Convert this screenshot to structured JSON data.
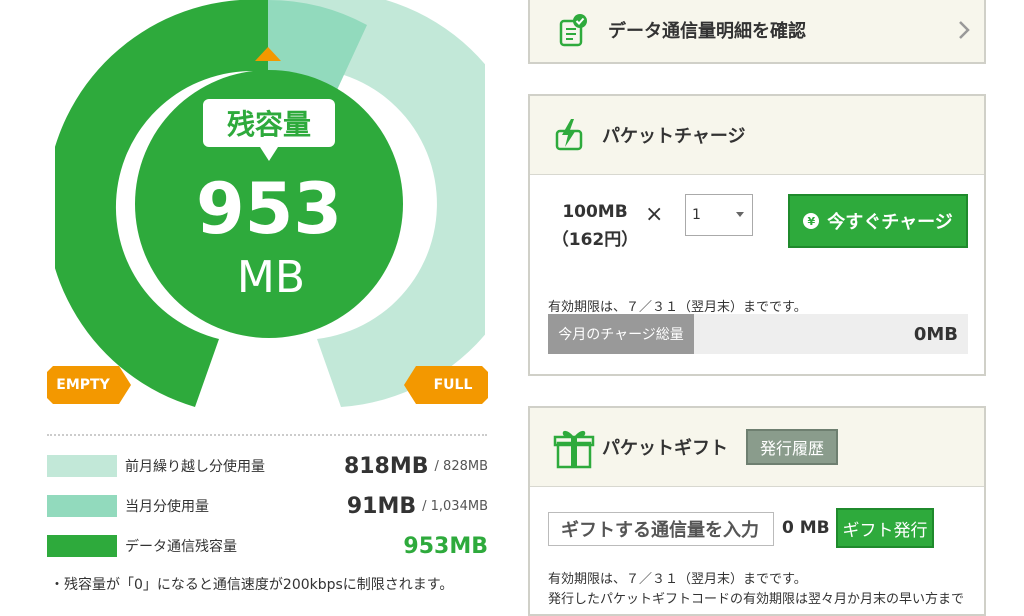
{
  "gauge": {
    "remaining_label": "残容量",
    "remaining_value": "953",
    "remaining_unit": "MB",
    "empty_label": "EMPTY",
    "full_label": "FULL",
    "colors": {
      "carryover": "#c2e8d8",
      "current": "#92dabd",
      "remaining": "#2eaa3c",
      "marker": "#f39800"
    }
  },
  "legend": [
    {
      "label": "前月繰り越し分使用量",
      "value": "818MB",
      "total": "/ 828MB",
      "color": "#c2e8d8"
    },
    {
      "label": "当月分使用量",
      "value": "91MB",
      "total": "/ 1,034MB",
      "color": "#92dabd"
    },
    {
      "label": "データ通信残容量",
      "value": "953MB",
      "total": "",
      "color": "#2eaa3c"
    }
  ],
  "notice": "・残容量が「0」になると通信速度が200kbpsに制限されます。",
  "details_link": {
    "label": "データ通信量明細を確認",
    "icon": "document-check-icon"
  },
  "charge": {
    "title": "パケットチャージ",
    "icon": "lightning-charge-icon",
    "size": "100MB",
    "price": "（162円）",
    "multiply": "×",
    "quantity": "1",
    "button": "今すぐチャージ",
    "yen": "¥",
    "validity": "有効期限は、７／３１（翌月末）までです。",
    "month_total_label": "今月のチャージ総量",
    "month_total_value": "0MB"
  },
  "gift": {
    "title": "パケットギフト",
    "icon": "gift-box-icon",
    "history_button": "発行履歴",
    "input_placeholder": "ギフトする通信量を入力",
    "unit_value": "0 MB",
    "issue_button": "ギフト発行",
    "validity": "有効期限は、７／３１（翌月末）までです。",
    "note": "発行したパケットギフトコードの有効期限は翌々月か月末の早い方まで"
  }
}
